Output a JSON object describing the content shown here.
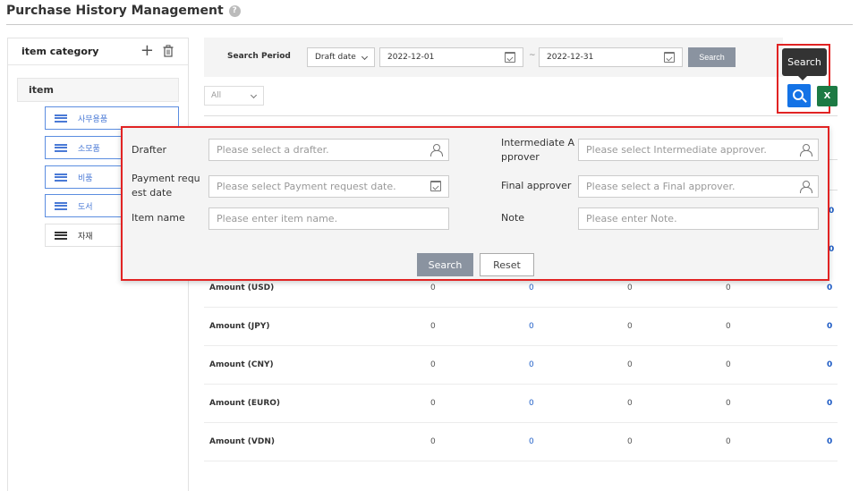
{
  "page": {
    "title": "Purchase History Management",
    "help_glyph": "?"
  },
  "left_panel": {
    "header": "item category",
    "root": "item",
    "children": [
      {
        "label": "사무용품",
        "selected": true
      },
      {
        "label": "소모품",
        "selected": true
      },
      {
        "label": "비품",
        "selected": true
      },
      {
        "label": "도서",
        "selected": true
      },
      {
        "label": "자재",
        "selected": false
      }
    ]
  },
  "search_bar": {
    "period_label": "Search Period",
    "date_type": "Draft date",
    "start_date": "2022-12-01",
    "separator": "~",
    "end_date": "2022-12-31",
    "search_label": "Search"
  },
  "filter": {
    "all_label": "All"
  },
  "toolbar": {
    "tooltip": "Search",
    "excel_glyph": "X"
  },
  "advanced_search": {
    "drafter_label": "Drafter",
    "drafter_placeholder": "Please select a drafter.",
    "intermediate_label_1": "Intermediate A",
    "intermediate_label_2": "pprover",
    "intermediate_placeholder": "Please select Intermediate approver.",
    "payment_label_1": "Payment requ",
    "payment_label_2": "est date",
    "payment_placeholder": "Please select Payment request date.",
    "final_label": "Final approver",
    "final_placeholder": "Please select a Final approver.",
    "item_label": "Item name",
    "item_placeholder": "Please enter item name.",
    "note_label": "Note",
    "note_placeholder": "Please enter Note.",
    "search_label": "Search",
    "reset_label": "Reset"
  },
  "table": {
    "rows": [
      {
        "label": "Amount (USD)",
        "values": [
          "0",
          "0",
          "0",
          "0",
          "0"
        ]
      },
      {
        "label": "Amount (JPY)",
        "values": [
          "0",
          "0",
          "0",
          "0",
          "0"
        ]
      },
      {
        "label": "Amount (CNY)",
        "values": [
          "0",
          "0",
          "0",
          "0",
          "0"
        ]
      },
      {
        "label": "Amount (EURO)",
        "values": [
          "0",
          "0",
          "0",
          "0",
          "0"
        ]
      },
      {
        "label": "Amount (VDN)",
        "values": [
          "0",
          "0",
          "0",
          "0",
          "0"
        ]
      }
    ],
    "partial_values": [
      "0",
      "0"
    ]
  },
  "colors": {
    "primary": "#1473e6",
    "highlight": "#e12323",
    "button_gray": "#8a93a0",
    "excel": "#1d7a44"
  }
}
